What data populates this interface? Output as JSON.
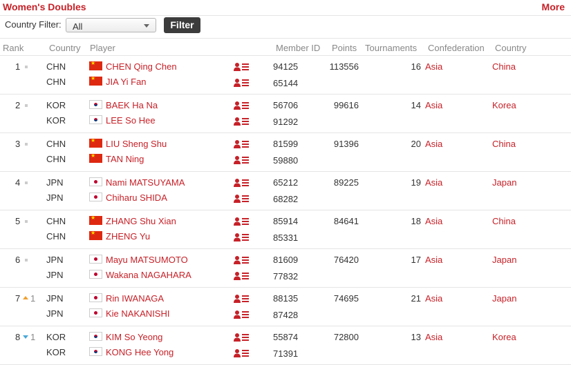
{
  "header": {
    "title": "Women's Doubles",
    "more_label": "More"
  },
  "filter": {
    "label": "Country Filter:",
    "selected": "All",
    "button_label": "Filter"
  },
  "columns": [
    "Rank",
    "Country",
    "Player",
    "Member ID",
    "Points",
    "Tournaments",
    "Confederation",
    "Country"
  ],
  "rows": [
    {
      "rank": "1",
      "change": "",
      "trend": "none",
      "points": "113556",
      "tournaments": "16",
      "confederation": "Asia",
      "country": "China",
      "players": [
        {
          "country": "CHN",
          "name": "CHEN Qing Chen",
          "member_id": "94125"
        },
        {
          "country": "CHN",
          "name": "JIA Yi Fan",
          "member_id": "65144"
        }
      ]
    },
    {
      "rank": "2",
      "change": "",
      "trend": "none",
      "points": "99616",
      "tournaments": "14",
      "confederation": "Asia",
      "country": "Korea",
      "players": [
        {
          "country": "KOR",
          "name": "BAEK Ha Na",
          "member_id": "56706"
        },
        {
          "country": "KOR",
          "name": "LEE So Hee",
          "member_id": "91292"
        }
      ]
    },
    {
      "rank": "3",
      "change": "",
      "trend": "none",
      "points": "91396",
      "tournaments": "20",
      "confederation": "Asia",
      "country": "China",
      "players": [
        {
          "country": "CHN",
          "name": "LIU Sheng Shu",
          "member_id": "81599"
        },
        {
          "country": "CHN",
          "name": "TAN Ning",
          "member_id": "59880"
        }
      ]
    },
    {
      "rank": "4",
      "change": "",
      "trend": "none",
      "points": "89225",
      "tournaments": "19",
      "confederation": "Asia",
      "country": "Japan",
      "players": [
        {
          "country": "JPN",
          "name": "Nami MATSUYAMA",
          "member_id": "65212"
        },
        {
          "country": "JPN",
          "name": "Chiharu SHIDA",
          "member_id": "68282"
        }
      ]
    },
    {
      "rank": "5",
      "change": "",
      "trend": "none",
      "points": "84641",
      "tournaments": "18",
      "confederation": "Asia",
      "country": "China",
      "players": [
        {
          "country": "CHN",
          "name": "ZHANG Shu Xian",
          "member_id": "85914"
        },
        {
          "country": "CHN",
          "name": "ZHENG Yu",
          "member_id": "85331"
        }
      ]
    },
    {
      "rank": "6",
      "change": "",
      "trend": "none",
      "points": "76420",
      "tournaments": "17",
      "confederation": "Asia",
      "country": "Japan",
      "players": [
        {
          "country": "JPN",
          "name": "Mayu MATSUMOTO",
          "member_id": "81609"
        },
        {
          "country": "JPN",
          "name": "Wakana NAGAHARA",
          "member_id": "77832"
        }
      ]
    },
    {
      "rank": "7",
      "change": "1",
      "trend": "up",
      "points": "74695",
      "tournaments": "21",
      "confederation": "Asia",
      "country": "Japan",
      "players": [
        {
          "country": "JPN",
          "name": "Rin IWANAGA",
          "member_id": "88135"
        },
        {
          "country": "JPN",
          "name": "Kie NAKANISHI",
          "member_id": "87428"
        }
      ]
    },
    {
      "rank": "8",
      "change": "1",
      "trend": "down",
      "points": "72800",
      "tournaments": "13",
      "confederation": "Asia",
      "country": "Korea",
      "players": [
        {
          "country": "KOR",
          "name": "KIM So Yeong",
          "member_id": "55874"
        },
        {
          "country": "KOR",
          "name": "KONG Hee Yong",
          "member_id": "71391"
        }
      ]
    }
  ],
  "colors": {
    "accent": "#c62128",
    "up": "#f0a030",
    "down": "#4aa8d8"
  }
}
